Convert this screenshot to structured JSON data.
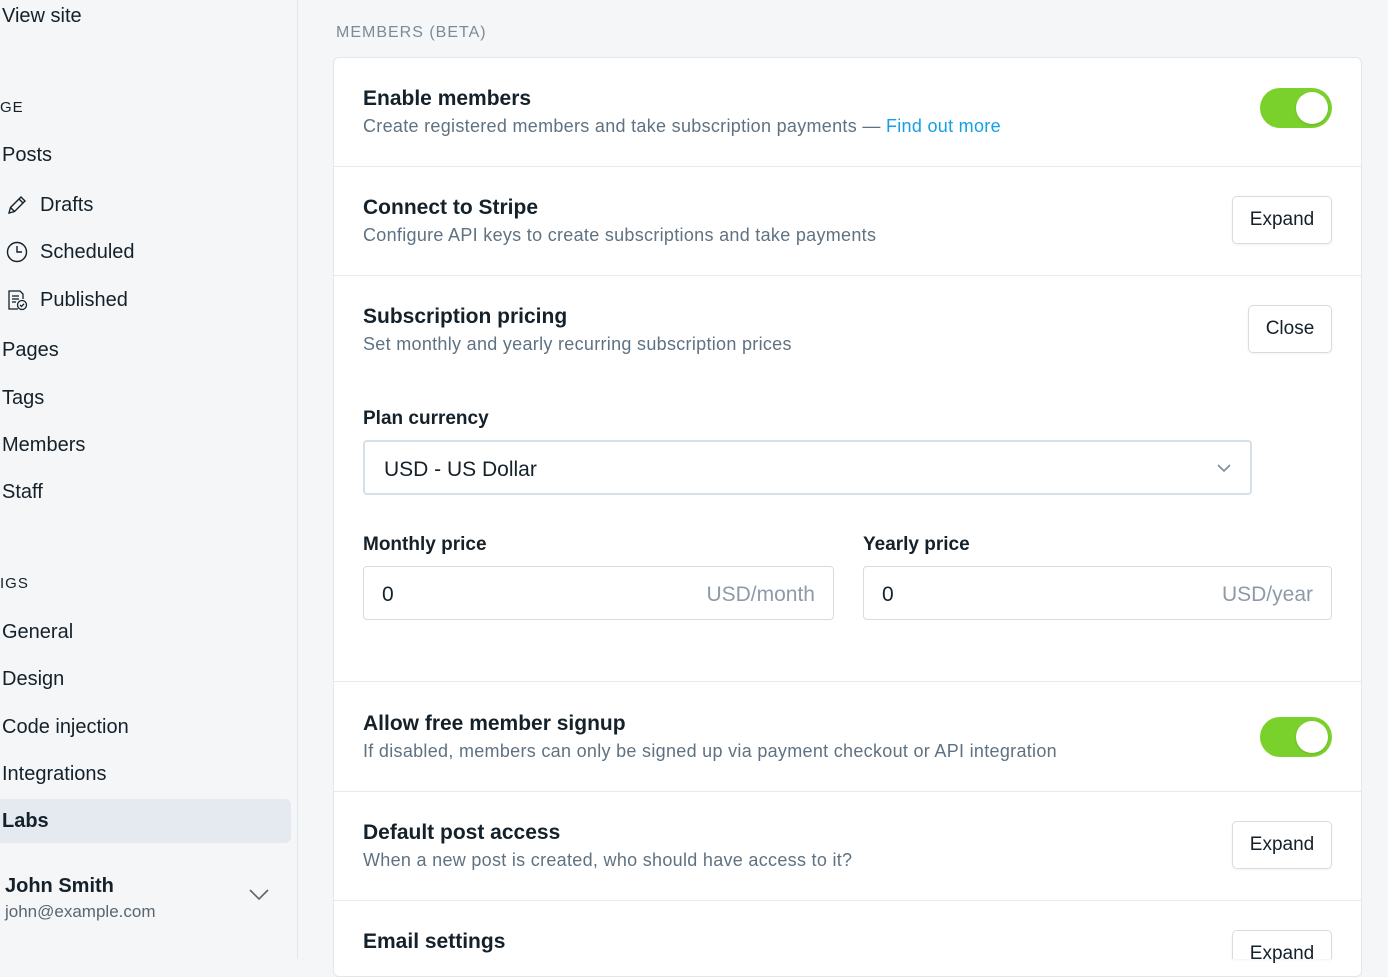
{
  "sidebar": {
    "view_site": "View site",
    "manage_heading": "GE",
    "posts": "Posts",
    "drafts": "Drafts",
    "scheduled": "Scheduled",
    "published": "Published",
    "pages": "Pages",
    "tags": "Tags",
    "members": "Members",
    "staff": "Staff",
    "settings_heading": "IGS",
    "general": "General",
    "design": "Design",
    "code_injection": "Code injection",
    "integrations": "Integrations",
    "labs": "Labs",
    "user": {
      "name": "John Smith",
      "email": "john@example.com"
    }
  },
  "main": {
    "section_title": "MEMBERS (BETA)",
    "enable_members": {
      "title": "Enable members",
      "desc": "Create registered members and take subscription payments — ",
      "link": "Find out more",
      "enabled": true
    },
    "stripe": {
      "title": "Connect to Stripe",
      "desc": "Configure API keys to create subscriptions and take payments",
      "button": "Expand"
    },
    "pricing": {
      "title": "Subscription pricing",
      "desc": "Set monthly and yearly recurring subscription prices",
      "button": "Close",
      "currency_label": "Plan currency",
      "currency_value": "USD - US Dollar",
      "monthly_label": "Monthly price",
      "monthly_value": "0",
      "monthly_unit": "USD/month",
      "yearly_label": "Yearly price",
      "yearly_value": "0",
      "yearly_unit": "USD/year"
    },
    "free_signup": {
      "title": "Allow free member signup",
      "desc": "If disabled, members can only be signed up via payment checkout or API integration",
      "enabled": true
    },
    "post_access": {
      "title": "Default post access",
      "desc": "When a new post is created, who should have access to it?",
      "button": "Expand"
    },
    "email_settings": {
      "title": "Email settings",
      "button": "Expand"
    }
  },
  "colors": {
    "toggle_on": "#7bd12b",
    "link": "#14a0e6",
    "active_nav": "#e5e9f0"
  }
}
